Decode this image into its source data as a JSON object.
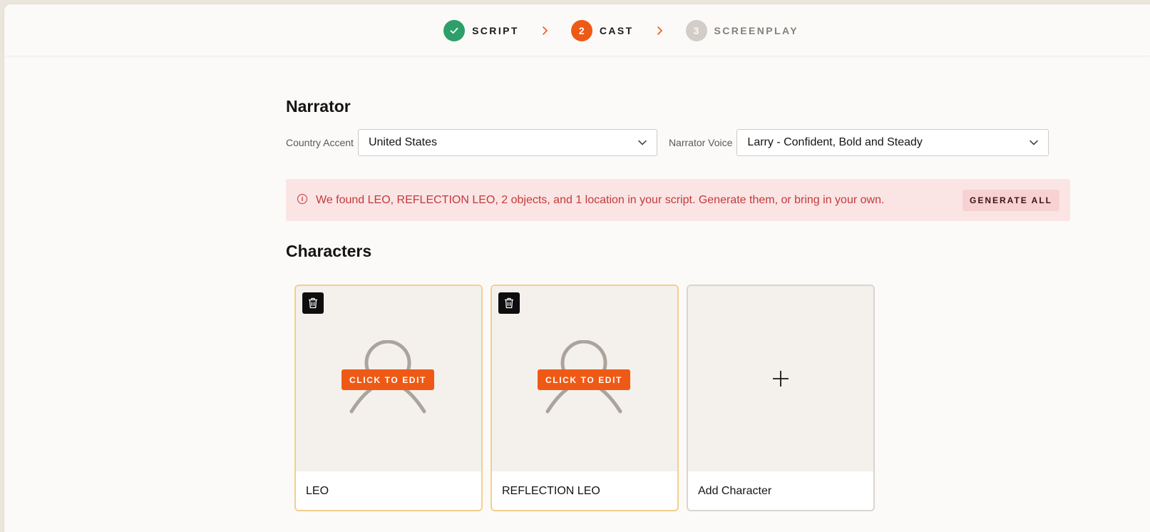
{
  "steps": [
    {
      "label": "SCRIPT",
      "state": "done",
      "number": ""
    },
    {
      "label": "CAST",
      "state": "active",
      "number": "2"
    },
    {
      "label": "SCREENPLAY",
      "state": "todo",
      "number": "3"
    }
  ],
  "narrator": {
    "title": "Narrator",
    "accent_label": "Country Accent",
    "accent_value": "United States",
    "voice_label": "Narrator Voice",
    "voice_value": "Larry - Confident, Bold and Steady"
  },
  "alert": {
    "icon": "info-icon",
    "text": "We found LEO, REFLECTION LEO, 2 objects, and 1 location in your script. Generate them, or bring in your own.",
    "button_label": "GENERATE ALL"
  },
  "characters": {
    "title": "Characters",
    "items": [
      {
        "name": "LEO",
        "edit_label": "CLICK TO EDIT"
      },
      {
        "name": "REFLECTION LEO",
        "edit_label": "CLICK TO EDIT"
      }
    ],
    "add_label": "Add Character"
  },
  "colors": {
    "accent": "#ee5a16",
    "success": "#2e9f6a",
    "alert_bg": "#fbe4e4",
    "alert_text": "#c23a3a",
    "card_border": "#f3cf8c"
  }
}
